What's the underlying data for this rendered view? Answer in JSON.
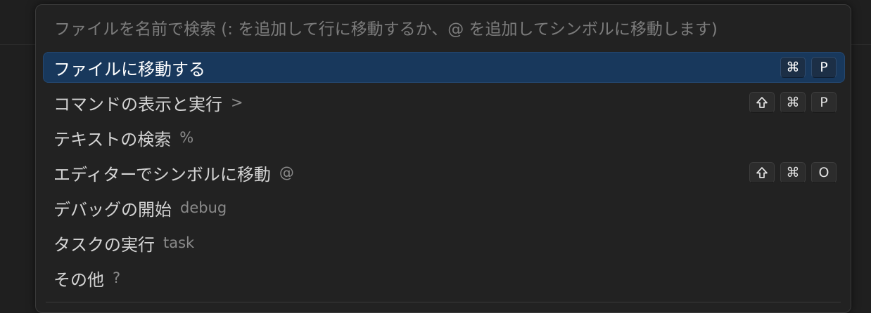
{
  "search": {
    "placeholder": "ファイルを名前で検索 (: を追加して行に移動するか、@ を追加してシンボルに移動します)"
  },
  "items": [
    {
      "label": "ファイルに移動する",
      "prefix": "",
      "selected": true,
      "keys": [
        "⌘",
        "P"
      ]
    },
    {
      "label": "コマンドの表示と実行",
      "prefix": ">",
      "selected": false,
      "keys": [
        "shift-icon",
        "⌘",
        "P"
      ]
    },
    {
      "label": "テキストの検索",
      "prefix": "%",
      "selected": false,
      "keys": []
    },
    {
      "label": "エディターでシンボルに移動",
      "prefix": "@",
      "selected": false,
      "keys": [
        "shift-icon",
        "⌘",
        "O"
      ]
    },
    {
      "label": "デバッグの開始",
      "prefix": "debug",
      "selected": false,
      "keys": []
    },
    {
      "label": "タスクの実行",
      "prefix": "task",
      "selected": false,
      "keys": []
    },
    {
      "label": "その他",
      "prefix": "?",
      "selected": false,
      "keys": []
    }
  ],
  "colors": {
    "selection_bg": "#18385c",
    "panel_bg": "#222222",
    "text": "#d4d4d4",
    "muted": "#8a8a8a"
  }
}
